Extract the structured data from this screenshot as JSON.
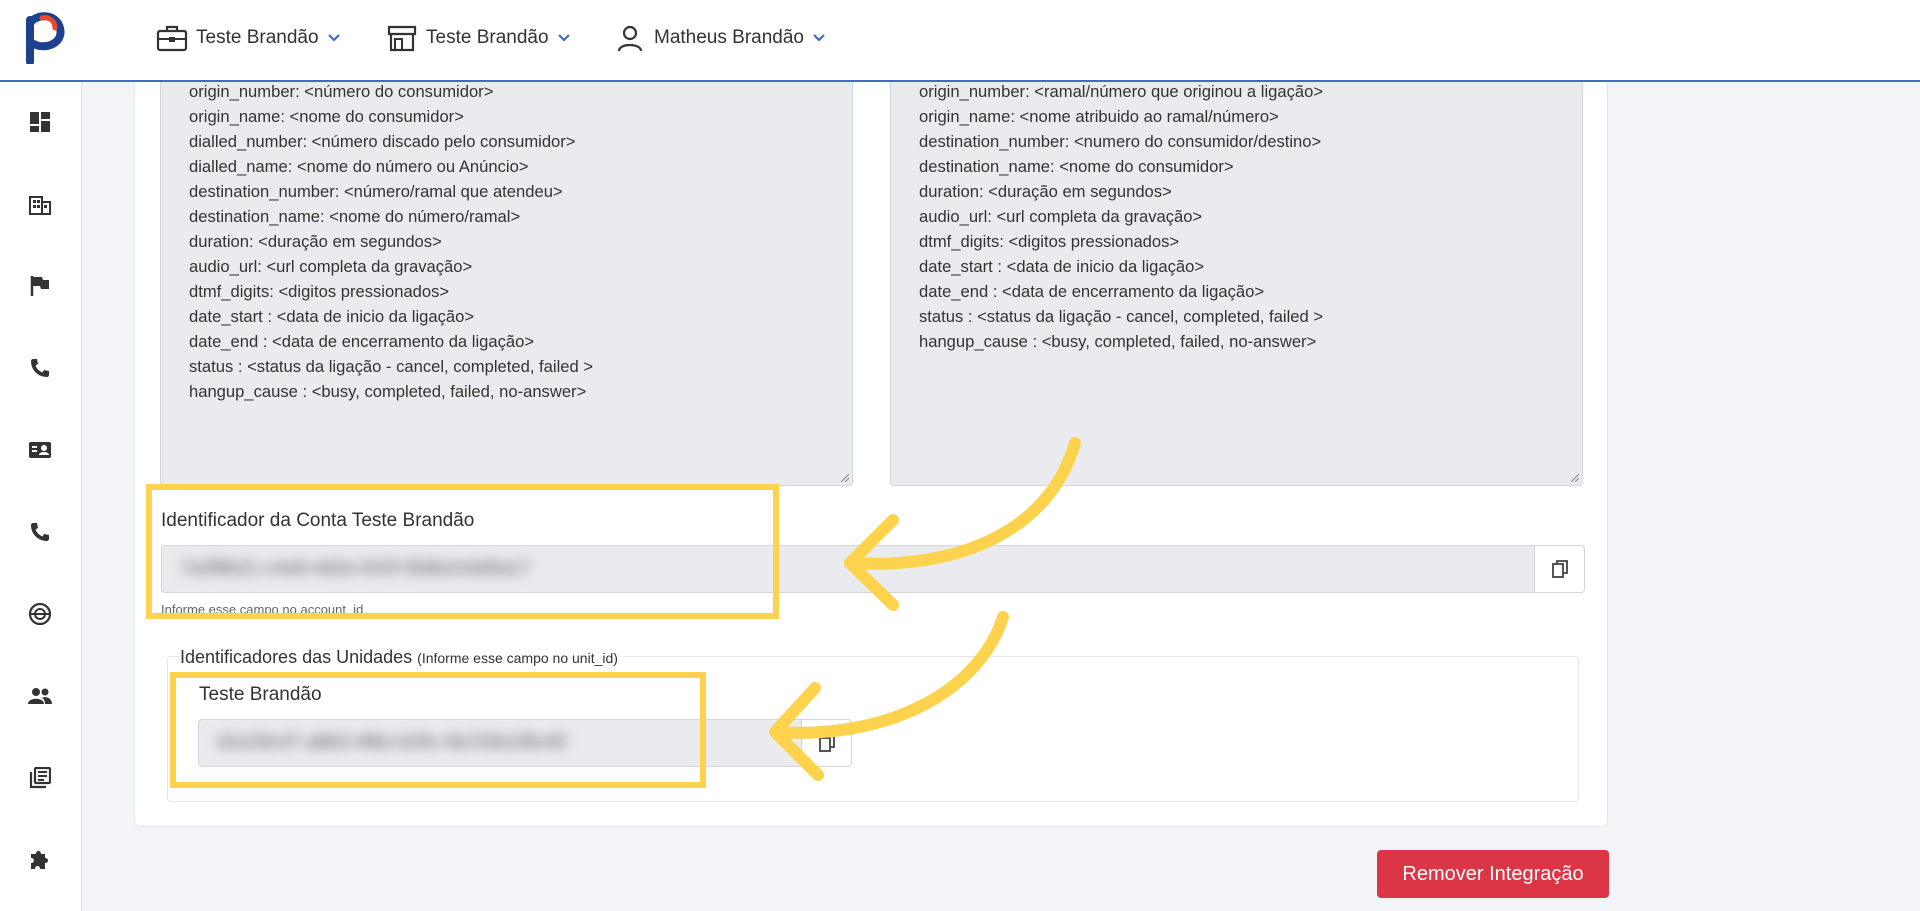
{
  "header": {
    "company_selector": "Teste Brandão",
    "unit_selector": "Teste Brandão",
    "user_menu": "Matheus Brandão"
  },
  "sidebar": {
    "items": [
      {
        "icon": "dashboard-icon"
      },
      {
        "icon": "building-icon"
      },
      {
        "icon": "flag-icon"
      },
      {
        "icon": "phone-icon"
      },
      {
        "icon": "contact-card-icon"
      },
      {
        "icon": "phone-icon"
      },
      {
        "icon": "tracking-icon"
      },
      {
        "icon": "people-icon"
      },
      {
        "icon": "library-books-icon"
      },
      {
        "icon": "puzzle-icon"
      }
    ]
  },
  "webhook_left": {
    "lines": [
      "origin_number: <número do consumidor>",
      "origin_name: <nome do consumidor>",
      "dialled_number: <número discado pelo consumidor>",
      "dialled_name: <nome do número ou Anúncio>",
      "destination_number: <número/ramal que atendeu>",
      "destination_name: <nome do número/ramal>",
      "duration: <duração em segundos>",
      "audio_url: <url completa da gravação>",
      "dtmf_digits: <digitos pressionados>",
      "date_start : <data de inicio da ligação>",
      "date_end : <data de encerramento da ligação>",
      "status :  <status da ligação - cancel, completed, failed >",
      "hangup_cause :  <busy, completed, failed, no-answer>"
    ]
  },
  "webhook_right": {
    "lines": [
      "origin_number: <ramal/número que originou a ligação>",
      "origin_name: <nome atribuido ao ramal/número>",
      "destination_number: <numero do consumidor/destino>",
      "destination_name: <nome do consumidor>",
      "duration: <duração em segundos>",
      "audio_url: <url completa da gravação>",
      "dtmf_digits: <digitos pressionados>",
      "date_start : <data de inicio da ligação>",
      "date_end : <data de encerramento da ligação>",
      "status :  <status da ligação - cancel, completed, failed >",
      "hangup_cause :  <busy, completed, failed, no-answer>"
    ]
  },
  "account": {
    "label": "Identificador da Conta Teste Brandão",
    "value": "7a3f9b21-c4e8-4d2a-91f3-5b8e2c6d0a17",
    "help": "Informe esse campo no account_id"
  },
  "units": {
    "title": "Identificadores das Unidades",
    "title_hint": "(Informe esse campo no unit_id)",
    "items": [
      {
        "name": "Teste Brandão",
        "value": "d1e29c47-a8b3-4f6e-b25c-9a7d3e1f8c40"
      }
    ]
  },
  "actions": {
    "remove_label": "Remover Integração"
  },
  "colors": {
    "accent": "#3d6fc1",
    "danger": "#dc3545",
    "highlight": "#fdd34d"
  }
}
